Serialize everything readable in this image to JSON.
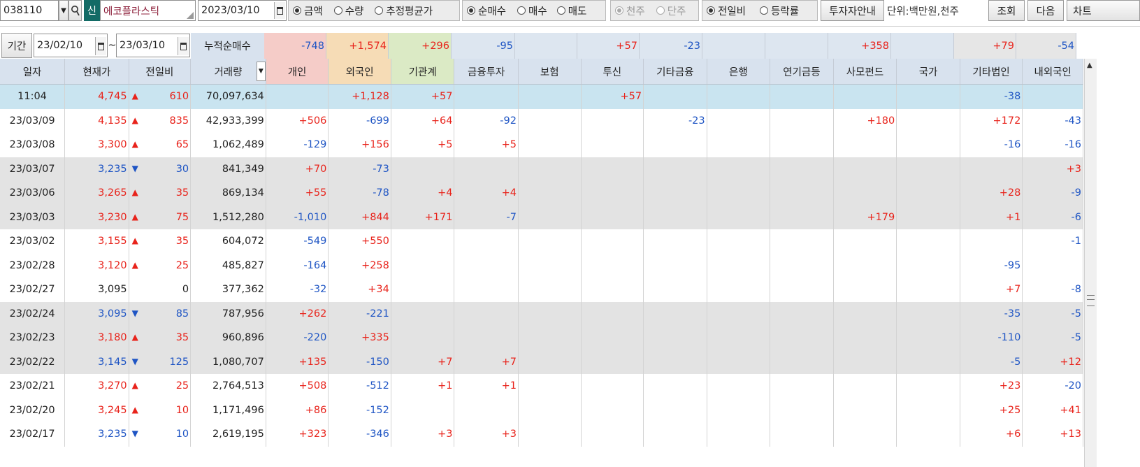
{
  "toolbar": {
    "stock_code": "038110",
    "new_badge": "신",
    "stock_name": "에코플라스틱",
    "date": "2023/03/10",
    "value_options": [
      "금액",
      "수량",
      "추정평균가"
    ],
    "value_selected": 0,
    "trade_options": [
      "순매수",
      "매수",
      "매도"
    ],
    "trade_selected": 0,
    "unit_options": [
      "천주",
      "단주"
    ],
    "unit_selected": 0,
    "change_options": [
      "전일비",
      "등락률"
    ],
    "change_selected": 0,
    "invest_guide_label": "투자자안내",
    "unit_text": "단위:백만원,천주",
    "query_label": "조회",
    "next_label": "다음",
    "chart_label": "차트"
  },
  "period": {
    "label": "기간",
    "from": "23/02/10",
    "tilde": "~",
    "to": "23/03/10",
    "cumulative_label": "누적순매수",
    "cumulative": [
      "-748",
      "+1,574",
      "+296",
      "-95",
      "",
      "+57",
      "-23",
      "",
      "",
      "+358",
      "",
      "+79",
      "-54"
    ]
  },
  "columns": [
    "일자",
    "현재가",
    "전일비",
    "거래량",
    "개인",
    "외국인",
    "기관계",
    "금융투자",
    "보험",
    "투신",
    "기타금융",
    "은행",
    "연기금등",
    "사모펀드",
    "국가",
    "기타법인",
    "내외국인"
  ],
  "rows": [
    {
      "date": "11:04",
      "price": "4,745",
      "dir": "up",
      "chg": "610",
      "vol": "70,097,634",
      "v": [
        "",
        "+1,128",
        "+57",
        "",
        "",
        "+57",
        "",
        "",
        "",
        "",
        "",
        "-38",
        ""
      ]
    },
    {
      "date": "23/03/09",
      "price": "4,135",
      "dir": "up",
      "chg": "835",
      "vol": "42,933,399",
      "v": [
        "+506",
        "-699",
        "+64",
        "-92",
        "",
        "",
        "-23",
        "",
        "",
        "+180",
        "",
        "+172",
        "-43"
      ]
    },
    {
      "date": "23/03/08",
      "price": "3,300",
      "dir": "up",
      "chg": "65",
      "vol": "1,062,489",
      "v": [
        "-129",
        "+156",
        "+5",
        "+5",
        "",
        "",
        "",
        "",
        "",
        "",
        "",
        "-16",
        "-16"
      ]
    },
    {
      "date": "23/03/07",
      "price": "3,235",
      "dir": "down",
      "chg": "30",
      "vol": "841,349",
      "v": [
        "+70",
        "-73",
        "",
        "",
        "",
        "",
        "",
        "",
        "",
        "",
        "",
        "",
        "+3"
      ]
    },
    {
      "date": "23/03/06",
      "price": "3,265",
      "dir": "up",
      "chg": "35",
      "vol": "869,134",
      "v": [
        "+55",
        "-78",
        "+4",
        "+4",
        "",
        "",
        "",
        "",
        "",
        "",
        "",
        "+28",
        "-9"
      ]
    },
    {
      "date": "23/03/03",
      "price": "3,230",
      "dir": "up",
      "chg": "75",
      "vol": "1,512,280",
      "v": [
        "-1,010",
        "+844",
        "+171",
        "-7",
        "",
        "",
        "",
        "",
        "",
        "+179",
        "",
        "+1",
        "-6"
      ]
    },
    {
      "date": "23/03/02",
      "price": "3,155",
      "dir": "up",
      "chg": "35",
      "vol": "604,072",
      "v": [
        "-549",
        "+550",
        "",
        "",
        "",
        "",
        "",
        "",
        "",
        "",
        "",
        "",
        "-1"
      ]
    },
    {
      "date": "23/02/28",
      "price": "3,120",
      "dir": "up",
      "chg": "25",
      "vol": "485,827",
      "v": [
        "-164",
        "+258",
        "",
        "",
        "",
        "",
        "",
        "",
        "",
        "",
        "",
        "-95",
        ""
      ]
    },
    {
      "date": "23/02/27",
      "price": "3,095",
      "dir": "flat",
      "chg": "0",
      "vol": "377,362",
      "v": [
        "-32",
        "+34",
        "",
        "",
        "",
        "",
        "",
        "",
        "",
        "",
        "",
        "+7",
        "-8"
      ]
    },
    {
      "date": "23/02/24",
      "price": "3,095",
      "dir": "down",
      "chg": "85",
      "vol": "787,956",
      "v": [
        "+262",
        "-221",
        "",
        "",
        "",
        "",
        "",
        "",
        "",
        "",
        "",
        "-35",
        "-5"
      ]
    },
    {
      "date": "23/02/23",
      "price": "3,180",
      "dir": "up",
      "chg": "35",
      "vol": "960,896",
      "v": [
        "-220",
        "+335",
        "",
        "",
        "",
        "",
        "",
        "",
        "",
        "",
        "",
        "-110",
        "-5"
      ]
    },
    {
      "date": "23/02/22",
      "price": "3,145",
      "dir": "down",
      "chg": "125",
      "vol": "1,080,707",
      "v": [
        "+135",
        "-150",
        "+7",
        "+7",
        "",
        "",
        "",
        "",
        "",
        "",
        "",
        "-5",
        "+12"
      ]
    },
    {
      "date": "23/02/21",
      "price": "3,270",
      "dir": "up",
      "chg": "25",
      "vol": "2,764,513",
      "v": [
        "+508",
        "-512",
        "+1",
        "+1",
        "",
        "",
        "",
        "",
        "",
        "",
        "",
        "+23",
        "-20"
      ]
    },
    {
      "date": "23/02/20",
      "price": "3,245",
      "dir": "up",
      "chg": "10",
      "vol": "1,171,496",
      "v": [
        "+86",
        "-152",
        "",
        "",
        "",
        "",
        "",
        "",
        "",
        "",
        "",
        "+25",
        "+41"
      ]
    },
    {
      "date": "23/02/17",
      "price": "3,235",
      "dir": "down",
      "chg": "10",
      "vol": "2,619,195",
      "v": [
        "+323",
        "-346",
        "+3",
        "+3",
        "",
        "",
        "",
        "",
        "",
        "",
        "",
        "+6",
        "+13"
      ]
    }
  ],
  "colors": {
    "up": "#e8231b",
    "down": "#1f55c4",
    "header_bg": "#d8e2ee",
    "highlight_row": "#c9e4f0",
    "shaded_row": "#e3e3e3",
    "personal_header": "#f5ccc8",
    "foreign_header": "#f6dcb6",
    "institution_header": "#dbeac5",
    "badge_bg": "#136b66"
  }
}
